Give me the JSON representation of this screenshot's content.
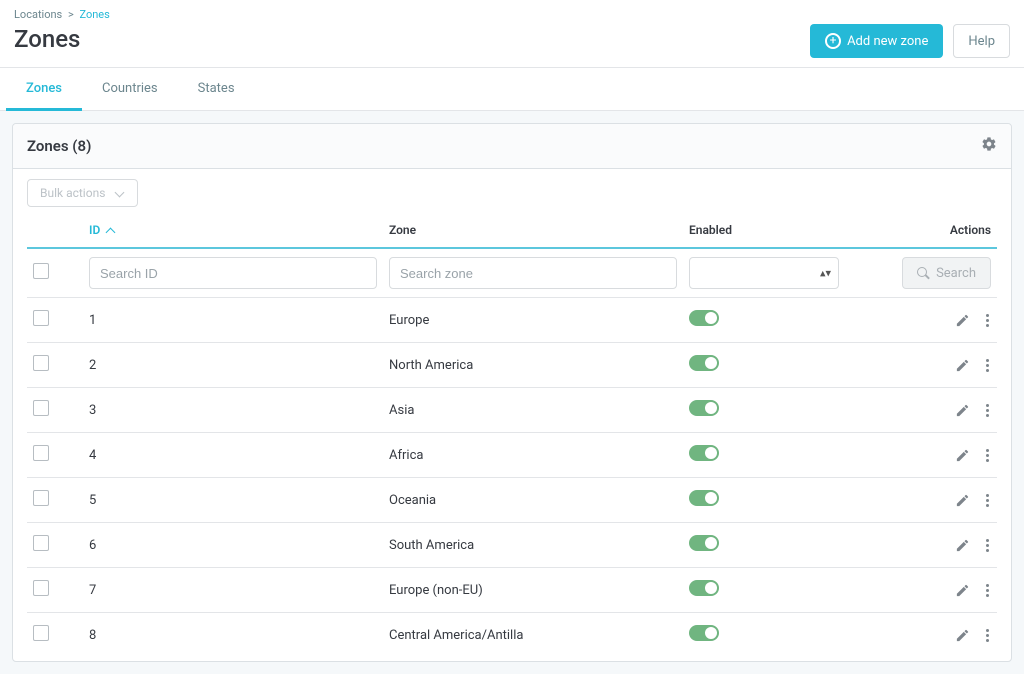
{
  "breadcrumb": {
    "root": "Locations",
    "current": "Zones"
  },
  "page_title": "Zones",
  "buttons": {
    "add_new_zone": "Add new zone",
    "help": "Help",
    "search": "Search",
    "bulk_actions": "Bulk actions"
  },
  "tabs": [
    {
      "label": "Zones",
      "active": true
    },
    {
      "label": "Countries",
      "active": false
    },
    {
      "label": "States",
      "active": false
    }
  ],
  "panel_title": "Zones (8)",
  "columns": {
    "id": "ID",
    "zone": "Zone",
    "enabled": "Enabled",
    "actions": "Actions"
  },
  "filters": {
    "id_placeholder": "Search ID",
    "zone_placeholder": "Search zone"
  },
  "rows": [
    {
      "id": "1",
      "zone": "Europe",
      "enabled": true
    },
    {
      "id": "2",
      "zone": "North America",
      "enabled": true
    },
    {
      "id": "3",
      "zone": "Asia",
      "enabled": true
    },
    {
      "id": "4",
      "zone": "Africa",
      "enabled": true
    },
    {
      "id": "5",
      "zone": "Oceania",
      "enabled": true
    },
    {
      "id": "6",
      "zone": "South America",
      "enabled": true
    },
    {
      "id": "7",
      "zone": "Europe (non-EU)",
      "enabled": true
    },
    {
      "id": "8",
      "zone": "Central America/Antilla",
      "enabled": true
    }
  ]
}
